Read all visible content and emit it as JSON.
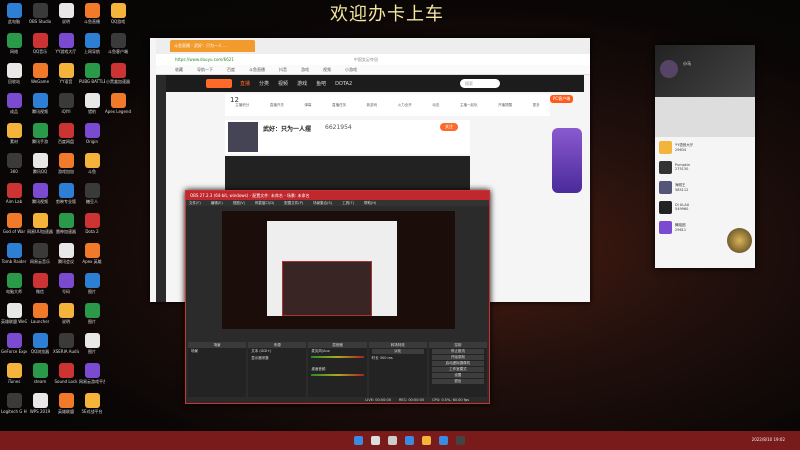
{
  "banner": "欢迎办卡上车",
  "desktop_icons": [
    [
      "此电脑",
      "OBS Studio",
      "说明",
      "斗鱼直播",
      "QQ游戏"
    ],
    [
      "网络",
      "QQ音乐",
      "YY游戏大厅",
      "上网导航",
      "斗鱼客户端"
    ],
    [
      "回收站",
      "WeGame",
      "YY语音",
      "PUBG BATTLEGR...",
      "小黑盒加速器"
    ],
    [
      "成品",
      "腾讯视频",
      "iQIYI",
      "猎豹",
      "Apex Legends"
    ],
    [
      "素材",
      "腾讯手游",
      "百度网盘",
      "Origin"
    ],
    [
      "360",
      "腾讯QQ",
      "游戏加加",
      "斗鱼"
    ],
    [
      "Aim Lab",
      "腾讯视频",
      "剪映专业版",
      "糖豆人"
    ],
    [
      "God of War",
      "网易UU加速器",
      "雷神加速器",
      "Dota 2"
    ],
    [
      "Tomb Raider",
      "网易云音乐",
      "腾讯会议",
      "Apex 英雄"
    ],
    [
      "电脑大师",
      "微信",
      "号码",
      "图片"
    ],
    [
      "英雄联盟 WeGame版",
      "Launcher",
      "说明",
      "图片"
    ],
    [
      "GeForce Experience",
      "QQ浏览器",
      "XSERIA Audio",
      "图片"
    ],
    [
      "iTunes",
      "steam",
      "Sound Lock",
      "网易云游戏平台"
    ],
    [
      "Logitech G HUB",
      "WPS 2019",
      "英雄联盟",
      "5E对战平台"
    ]
  ],
  "icon_colors": [
    "#2d7fd3",
    "#3a3a3a",
    "#e8e8e8",
    "#f07a2a",
    "#f4b43c",
    "#2a9a4a",
    "#c33",
    "#7a4ad0"
  ],
  "browser": {
    "tab_title": "斗鱼直播 - 武好：只为一人 ...",
    "url": "https://www.douyu.com/6621",
    "search_hint": "中国女足夺冠",
    "bookmarks": [
      "收藏",
      "导航一下",
      "百度",
      "斗鱼直播",
      "抖音",
      "游戏",
      "视频",
      "小游戏"
    ],
    "nav": [
      "首页",
      "直播",
      "分类",
      "视频",
      "游戏",
      "鱼吧",
      "DOTA2"
    ],
    "search_placeholder": "搜索",
    "functions": [
      "主播积分",
      "直播开关",
      "弹幕",
      "直播任务",
      "新游戏",
      "火力全开",
      "动态",
      "主播一起玩",
      "开播提醒",
      "更多"
    ],
    "follow_count": "12",
    "streamer_name": "武好：只为一人摆",
    "room_id": "6621954",
    "follow_button": "关注",
    "pc_client": "PC客户端"
  },
  "obs": {
    "title": "OBS 27.2.3 (64-bit, windows) - 配置文件: 未命名 - 场景: 未命名",
    "menu": [
      "文件(F)",
      "编辑(E)",
      "视图(V)",
      "停靠窗口(D)",
      "配置文件(P)",
      "场景集合(S)",
      "工具(T)",
      "帮助(H)"
    ],
    "docks": [
      "场景",
      "来源",
      "混音器",
      "转场特效",
      "控制"
    ],
    "scene": "场景",
    "sources": [
      "文本 (GDI+)",
      "显示器采集"
    ],
    "mixer": [
      "麦克风/Aux",
      "桌面音频"
    ],
    "transition": "淡化",
    "duration_label": "时长",
    "duration": "300 ms",
    "controls": [
      "停止推流",
      "开始录制",
      "启动虚拟摄像机",
      "工作室模式",
      "设置",
      "退出"
    ],
    "status": [
      "LIVE: 00:00:00",
      "REC: 00:00:00",
      "CPU: 0.5%, 60.00 fps"
    ]
  },
  "qq": {
    "name": "小马",
    "rows": [
      {
        "name": "YY语音大厅",
        "id": "29634"
      },
      {
        "name": "Pumpkin",
        "id": "275130"
      },
      {
        "name": "海贼王",
        "id": "585112"
      },
      {
        "name": "Di ULAU",
        "id": "549960"
      },
      {
        "name": "舞蹈团",
        "id": "29611"
      }
    ]
  },
  "tray": {
    "time": "19:02",
    "date": "2022/8/10"
  }
}
